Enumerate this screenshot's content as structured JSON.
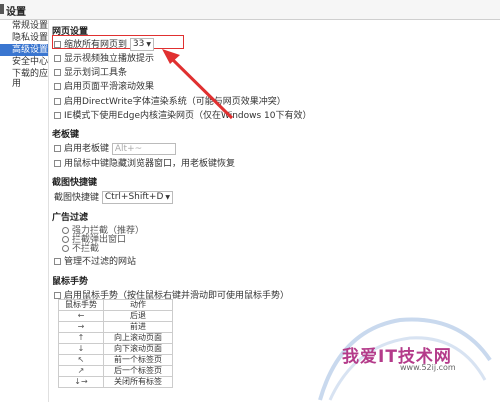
{
  "window": {
    "title": "设置"
  },
  "sidebar": {
    "items": [
      {
        "label": "常规设置"
      },
      {
        "label": "隐私设置"
      },
      {
        "label": "高级设置",
        "active": true
      },
      {
        "label": "安全中心"
      },
      {
        "label": "下载的应用"
      }
    ]
  },
  "sections": {
    "web": {
      "title": "网页设置",
      "zoom_label": "缩放所有网页到",
      "zoom_value": "33",
      "options": [
        "显示视频独立播放提示",
        "显示划词工具条",
        "启用页面平滑滚动效果",
        "启用DirectWrite字体渲染系统（可能与网页效果冲突）",
        "IE模式下使用Edge内核渲染网页（仅在Windows 10下有效）"
      ]
    },
    "boss": {
      "title": "老板键",
      "enable_label": "启用老板键",
      "hotkey_value": "Alt+~",
      "middle_click": "用鼠标中键隐藏浏览器窗口，用老板键恢复"
    },
    "screenshot": {
      "title": "截图快捷键",
      "label": "截图快捷键",
      "value": "Ctrl+Shift+D"
    },
    "adfilter": {
      "title": "广告过滤",
      "opt1": "强力拦截（推荐）",
      "opt2": "拦截弹出窗口",
      "opt3": "不拦截",
      "manage": "管理不过滤的网站"
    },
    "mouse": {
      "title": "鼠标手势",
      "enable": "启用鼠标手势（按住鼠标右键并滑动即可使用鼠标手势）",
      "headers": [
        "鼠标手势",
        "动作"
      ],
      "rows": [
        {
          "gesture": "←",
          "action": "后退"
        },
        {
          "gesture": "→",
          "action": "前进"
        },
        {
          "gesture": "↑",
          "action": "向上滚动页面"
        },
        {
          "gesture": "↓",
          "action": "向下滚动页面"
        },
        {
          "gesture": "↖",
          "action": "前一个标签页"
        },
        {
          "gesture": "↗",
          "action": "后一个标签页"
        },
        {
          "gesture": "↓→",
          "action": "关闭所有标签"
        }
      ]
    }
  },
  "watermark": {
    "text": "我爱IT技术网",
    "url": "www.52ij.com"
  },
  "colors": {
    "accent": "#3a76d0",
    "highlight": "#e03030",
    "watermark": "#b43b8a"
  }
}
